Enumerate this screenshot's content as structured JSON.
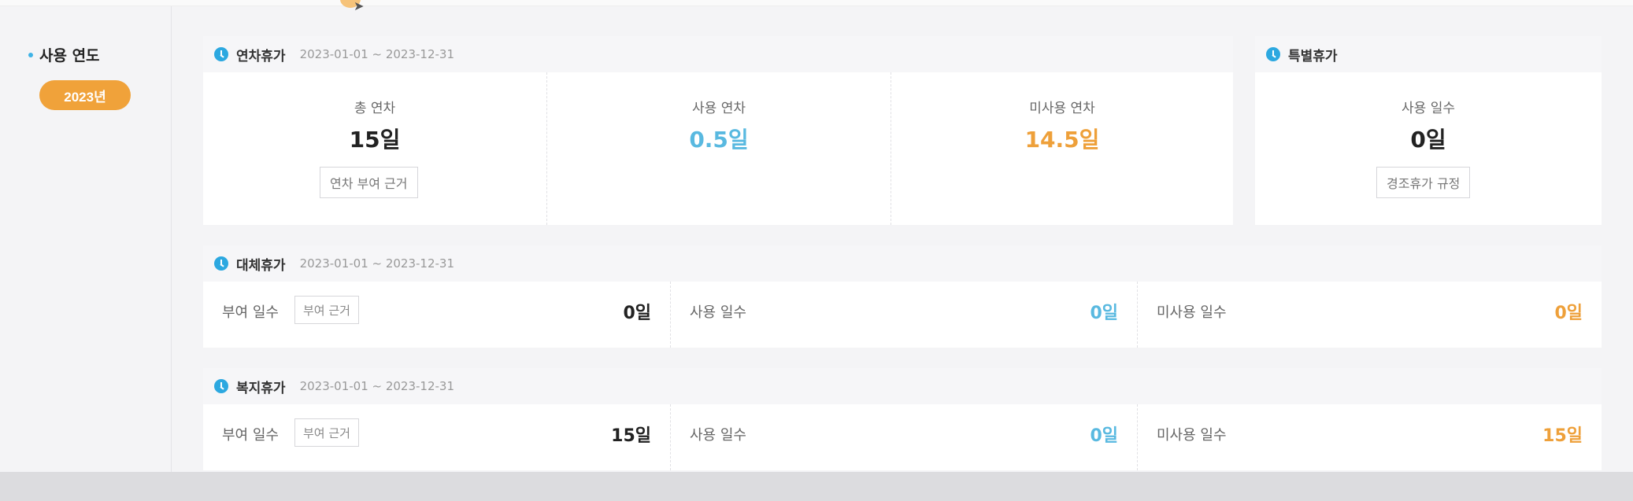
{
  "sidebar": {
    "title": "사용 연도",
    "year": "2023년"
  },
  "annual": {
    "title": "연차휴가",
    "period": "2023-01-01 ~ 2023-12-31",
    "total": {
      "label": "총 연차",
      "value": "15일",
      "button": "연차 부여 근거"
    },
    "used": {
      "label": "사용 연차",
      "value": "0.5일"
    },
    "unused": {
      "label": "미사용 연차",
      "value": "14.5일"
    }
  },
  "special": {
    "title": "특별휴가",
    "used": {
      "label": "사용 일수",
      "value": "0일",
      "button": "경조휴가 규정"
    }
  },
  "substitute": {
    "title": "대체휴가",
    "period": "2023-01-01 ~ 2023-12-31",
    "granted": {
      "label": "부여 일수",
      "button": "부여 근거",
      "value": "0일"
    },
    "used": {
      "label": "사용 일수",
      "value": "0일"
    },
    "unused": {
      "label": "미사용 일수",
      "value": "0일"
    }
  },
  "welfare": {
    "title": "복지휴가",
    "period": "2023-01-01 ~ 2023-12-31",
    "granted": {
      "label": "부여 일수",
      "button": "부여 근거",
      "value": "15일"
    },
    "used": {
      "label": "사용 일수",
      "value": "0일"
    },
    "unused": {
      "label": "미사용 일수",
      "value": "15일"
    }
  },
  "colors": {
    "accent_orange": "#f0a23a",
    "blue": "#59b9e0",
    "orange_value": "#eea03a",
    "icon_blue": "#2ca8e0"
  },
  "icons": {
    "section": "clock-icon",
    "cursor": "mouse-cursor-icon"
  }
}
